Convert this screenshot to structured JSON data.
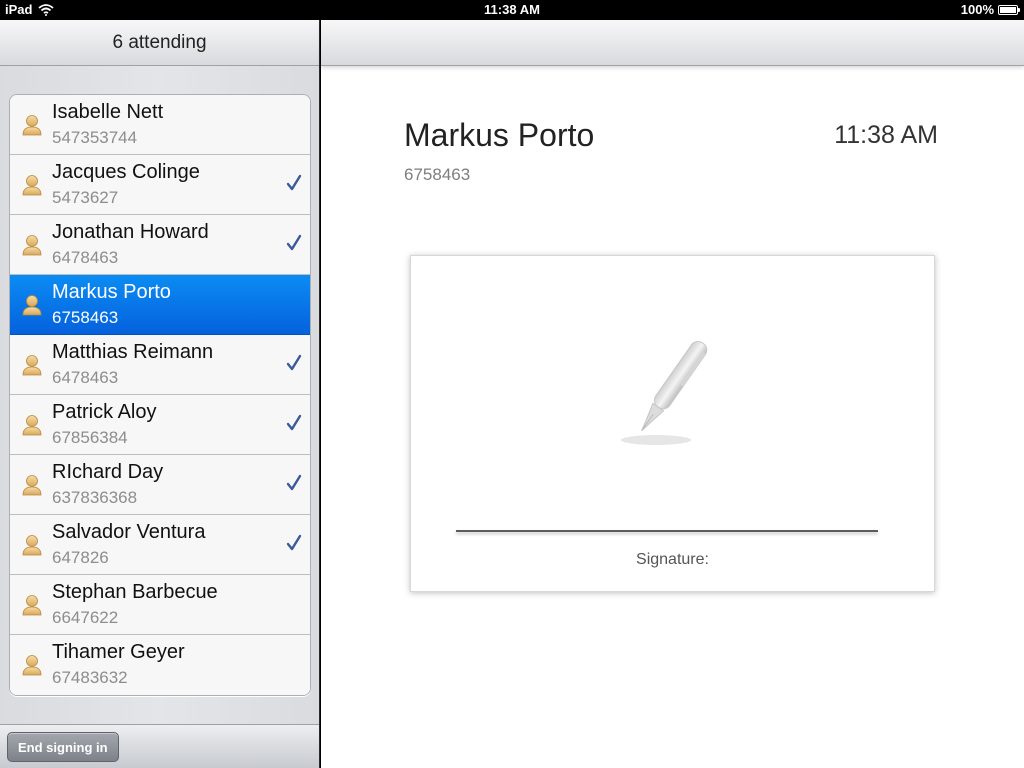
{
  "status_bar": {
    "device": "iPad",
    "time": "11:38 AM",
    "battery": "100%",
    "icons": [
      "wifi-icon",
      "battery-icon"
    ]
  },
  "master": {
    "title": "6 attending",
    "attendees": [
      {
        "name": "Isabelle Nett",
        "number": "547353744",
        "checked": false,
        "selected": false
      },
      {
        "name": "Jacques Colinge",
        "number": "5473627",
        "checked": true,
        "selected": false
      },
      {
        "name": "Jonathan Howard",
        "number": "6478463",
        "checked": true,
        "selected": false
      },
      {
        "name": "Markus Porto",
        "number": "6758463",
        "checked": false,
        "selected": true
      },
      {
        "name": "Matthias Reimann",
        "number": "6478463",
        "checked": true,
        "selected": false
      },
      {
        "name": "Patrick Aloy",
        "number": "67856384",
        "checked": true,
        "selected": false
      },
      {
        "name": "RIchard Day",
        "number": "637836368",
        "checked": true,
        "selected": false
      },
      {
        "name": "Salvador Ventura",
        "number": "647826",
        "checked": true,
        "selected": false
      },
      {
        "name": "Stephan Barbecue",
        "number": "6647622",
        "checked": false,
        "selected": false
      },
      {
        "name": "Tihamer Geyer",
        "number": "67483632",
        "checked": false,
        "selected": false
      }
    ],
    "footer_button": "End signing in"
  },
  "detail": {
    "name": "Markus Porto",
    "number": "6758463",
    "time": "11:38 AM",
    "signature_label": "Signature:"
  },
  "colors": {
    "selection": "#0a7ced",
    "checkmark": "#3a5a9a"
  }
}
